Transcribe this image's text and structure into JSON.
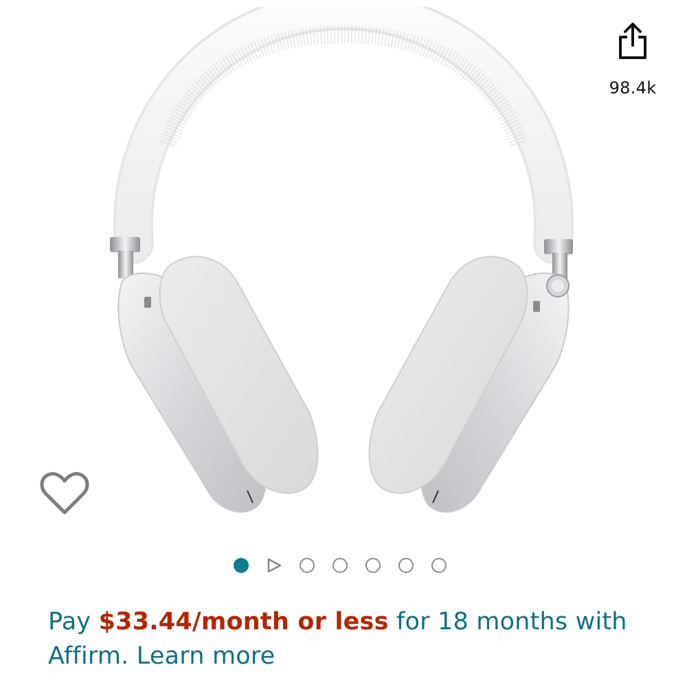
{
  "share": {
    "icon": "share-icon",
    "count": "98.4k"
  },
  "product_image": {
    "description_icon": "headphones-image"
  },
  "wishlist": {
    "icon": "heart-outline-icon"
  },
  "carousel": {
    "total": 7,
    "active_index": 0,
    "video_index": 1
  },
  "financing": {
    "prefix": "Pay ",
    "price": "$33.44/month or less",
    "middle": " for 18 months with",
    "provider": "Affirm.",
    "link": "Learn more"
  },
  "colors": {
    "accent": "#0f7c90",
    "price": "#b12704",
    "link": "#0f6f82"
  }
}
